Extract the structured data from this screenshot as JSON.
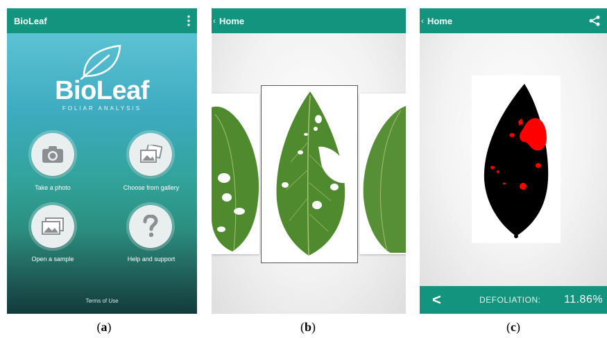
{
  "panel_a": {
    "title": "BioLeaf",
    "brand": "BioLeaf",
    "brand_sub": "FOLIAR ANALYSIS",
    "buttons": [
      {
        "label": "Take a photo",
        "icon": "camera-icon"
      },
      {
        "label": "Choose from gallery",
        "icon": "gallery-icon"
      },
      {
        "label": "Open a sample",
        "icon": "photos-icon"
      },
      {
        "label": "Help and support",
        "icon": "question-icon"
      }
    ],
    "terms": "Terms of Use"
  },
  "panel_b": {
    "title": "Home"
  },
  "panel_c": {
    "title": "Home",
    "defoliation_label": "DEFOLIATION:",
    "defoliation_value": "11.86%"
  },
  "captions": {
    "a_open": "(",
    "a_letter": "a",
    "a_close": ")",
    "b_open": "(",
    "b_letter": "b",
    "b_close": ")",
    "c_open": "(",
    "c_letter": "c",
    "c_close": ")"
  },
  "colors": {
    "appbar": "#13947f",
    "defoliation_red": "#ff0000",
    "leaf_green": "#4f8a2e"
  }
}
